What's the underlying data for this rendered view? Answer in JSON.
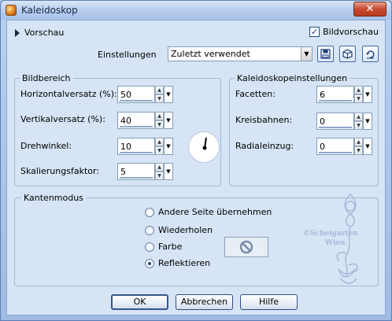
{
  "window": {
    "title": "Kaleidoskop",
    "close_label": "✕"
  },
  "preview": {
    "label": "Vorschau",
    "checkbox_label": "Bildvorschau",
    "checked": true
  },
  "settings": {
    "label": "Einstellungen",
    "value": "Zuletzt verwendet"
  },
  "bildbereich": {
    "title": "Bildbereich",
    "fields": [
      {
        "label": "Horizontalversatz (%):",
        "value": "50"
      },
      {
        "label": "Vertikalversatz (%):",
        "value": "40"
      },
      {
        "label": "Drehwinkel:",
        "value": "10"
      },
      {
        "label": "Skalierungsfaktor:",
        "value": "5"
      }
    ]
  },
  "kaleido": {
    "title": "Kaleidoskopeinstellungen",
    "fields": [
      {
        "label": "Facetten:",
        "value": "6"
      },
      {
        "label": "Kreisbahnen:",
        "value": "0"
      },
      {
        "label": "Radialeinzug:",
        "value": "0"
      }
    ]
  },
  "kantenmodus": {
    "title": "Kantenmodus",
    "options": [
      "Andere Seite übernehmen",
      "Wiederholen",
      "Farbe",
      "Reflektieren"
    ],
    "selected": "Reflektieren"
  },
  "buttons": {
    "ok": "OK",
    "cancel": "Abbrechen",
    "help": "Hilfe"
  },
  "watermark": {
    "line1": "©Scheigarten",
    "line2": "Wien"
  },
  "icons": [
    "dropdown-arrow-icon",
    "save-preset-icon",
    "reset-icon",
    "undo-icon",
    "spin-up-icon",
    "spin-down-icon",
    "no-color-icon"
  ],
  "colors": {
    "accent": "#2e4f86",
    "dialog_bg": "#d6e4f5",
    "title_bar": "#b5cdee",
    "close": "#c74b30"
  }
}
